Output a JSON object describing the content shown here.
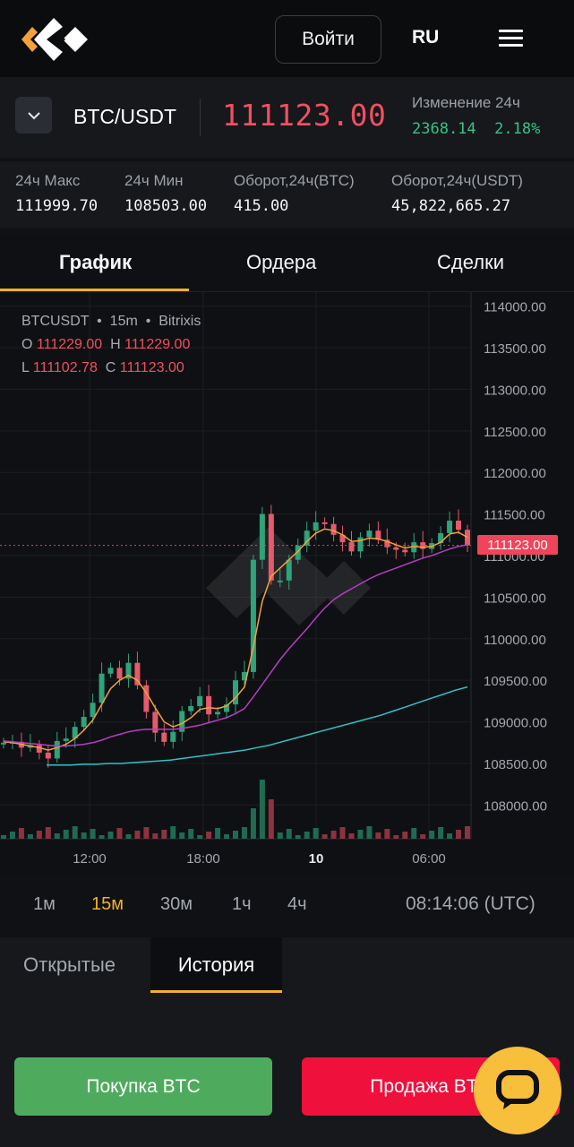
{
  "header": {
    "login_label": "Войти",
    "lang": "RU"
  },
  "pair": {
    "name": "BTC/USDT",
    "price": "111123.00",
    "change_label": "Изменение 24ч",
    "change_abs": "2368.14",
    "change_pct": "2.18%"
  },
  "stats": [
    {
      "label": "24ч Макс",
      "value": "111999.70"
    },
    {
      "label": "24ч Мин",
      "value": "108503.00"
    },
    {
      "label": "Оборот,24ч(BTC)",
      "value": "415.00"
    },
    {
      "label": "Оборот,24ч(USDT)",
      "value": "45,822,665.27"
    }
  ],
  "tabs": [
    "График",
    "Ордера",
    "Сделки"
  ],
  "chart_legend": {
    "symbol": "BTCUSDT",
    "interval": "15m",
    "exchange": "Bitrixis",
    "o_label": "O",
    "o": "111229.00",
    "h_label": "H",
    "h": "111229.00",
    "l_label": "L",
    "l": "111102.78",
    "c_label": "C",
    "c": "111123.00"
  },
  "chart_data": {
    "type": "line",
    "x_ticks": [
      "12:00",
      "18:00",
      "10",
      "06:00"
    ],
    "y_ticks": [
      "114000.00",
      "113500.00",
      "113000.00",
      "112500.00",
      "112000.00",
      "111500.00",
      "111000.00",
      "110500.00",
      "110000.00",
      "109500.00",
      "109000.00",
      "108500.00",
      "108000.00"
    ],
    "ylim": [
      107950,
      114050
    ],
    "last_price_tag": "111123.00",
    "colors": {
      "up": "#2fa37a",
      "down": "#e35b6c",
      "ma_fast": "#f2a23b",
      "ma_mid": "#b53ec3",
      "ma_slow": "#31c1c6"
    },
    "series": [
      {
        "values": [
          108750,
          108760,
          108690,
          108720,
          108630,
          108560,
          108770,
          108800,
          108940,
          109060,
          109230,
          109580,
          109650,
          109520,
          109710,
          109440,
          109120,
          108870,
          108760,
          108880,
          109130,
          109190,
          109310,
          109090,
          109120,
          109210,
          109500,
          109600,
          110950,
          111500,
          110700,
          110700,
          110950,
          111120,
          111300,
          111400,
          111380,
          111250,
          111160,
          111050,
          111220,
          111300,
          111190,
          111100,
          111070,
          111040,
          111160,
          111080,
          111150,
          111270,
          111420,
          111310,
          111123
        ]
      },
      {
        "values": [
          108760,
          108750,
          108730,
          108710,
          108690,
          108660,
          108690,
          108730,
          108800,
          108900,
          109020,
          109210,
          109400,
          109500,
          109560,
          109500,
          109350,
          109170,
          109000,
          108940,
          108980,
          109050,
          109150,
          109170,
          109160,
          109190,
          109290,
          109420,
          109900,
          110450,
          110750,
          110850,
          110950,
          111050,
          111170,
          111270,
          111320,
          111300,
          111250,
          111170,
          111180,
          111210,
          111200,
          111170,
          111130,
          111090,
          111110,
          111100,
          111110,
          111160,
          111260,
          111280,
          111220
        ]
      },
      {
        "values": [
          108770,
          108760,
          108750,
          108740,
          108730,
          108720,
          108710,
          108710,
          108720,
          108730,
          108750,
          108780,
          108820,
          108850,
          108880,
          108900,
          108910,
          108910,
          108910,
          108910,
          108920,
          108940,
          108960,
          108990,
          109020,
          109050,
          109100,
          109160,
          109300,
          109450,
          109600,
          109750,
          109880,
          110000,
          110120,
          110250,
          110370,
          110470,
          110540,
          110600,
          110660,
          110720,
          110770,
          110810,
          110850,
          110890,
          110930,
          110970,
          111000,
          111040,
          111080,
          111110,
          111130
        ]
      },
      {
        "values": [
          108480,
          108480,
          108480,
          108490,
          108490,
          108500,
          108500,
          108510,
          108520,
          108530,
          108540,
          108560,
          108580,
          108600,
          108620,
          108640,
          108660,
          108690,
          108720,
          108760,
          108800,
          108840,
          108880,
          108920,
          108960,
          109000,
          109040,
          109080,
          109130,
          109180,
          109230,
          109280,
          109330,
          109380,
          109420
        ]
      }
    ]
  },
  "timeframes": [
    "1м",
    "15м",
    "30м",
    "1ч",
    "4ч"
  ],
  "active_timeframe": 1,
  "clock": "08:14:06 (UTC)",
  "panel": {
    "tab_open": "Открытые",
    "tab_history": "История"
  },
  "buttons": {
    "buy": "Покупка BTC",
    "sell": "Продажа BTC"
  }
}
